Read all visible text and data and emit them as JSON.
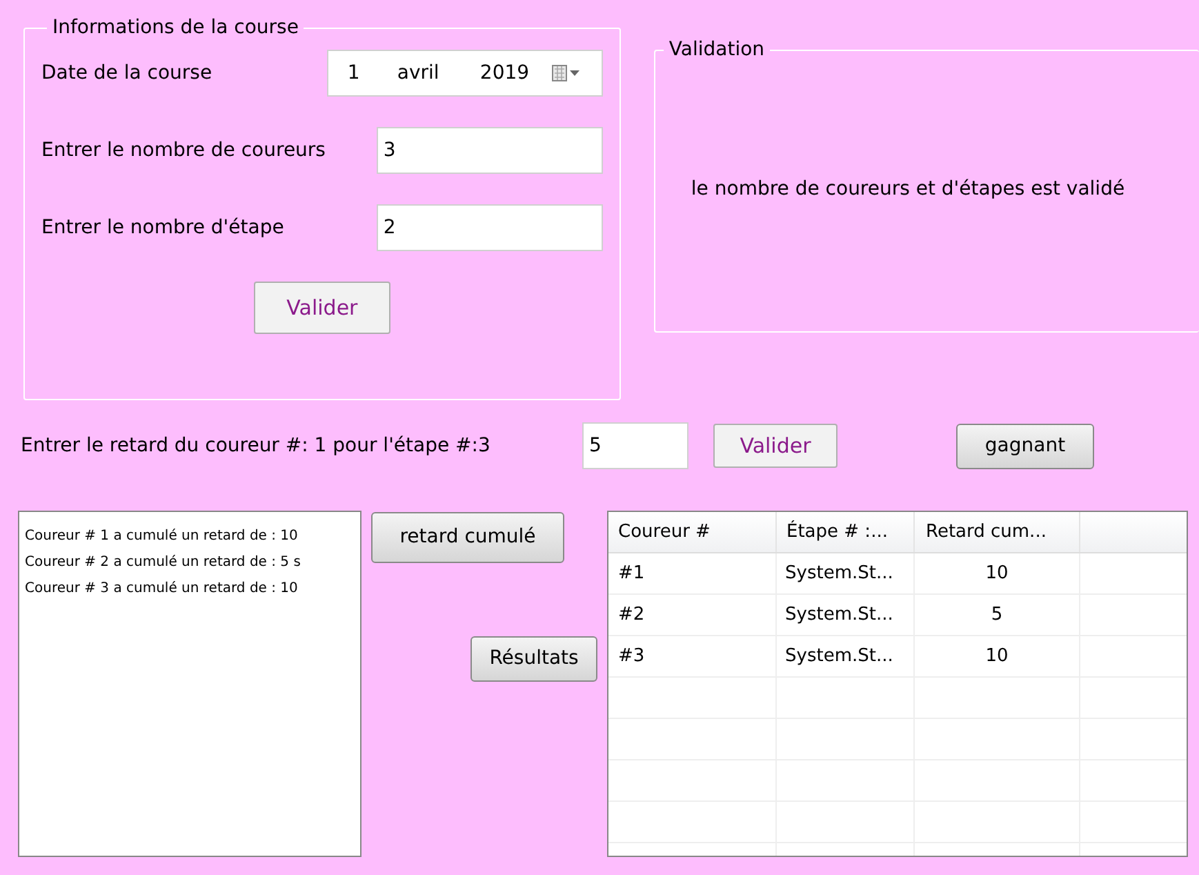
{
  "course_group": {
    "title": "Informations de la course",
    "date": {
      "label": "Date de la course",
      "day": "1",
      "month": "avril",
      "year": "2019"
    },
    "fields": [
      {
        "label": "Entrer le nombre de coureurs",
        "value": "3"
      },
      {
        "label": "Entrer le nombre d'étape",
        "value": "2"
      }
    ],
    "button": "Valider"
  },
  "validation_group": {
    "title": "Validation",
    "message": "le nombre de coureurs et d'étapes est validé"
  },
  "delay_entry": {
    "label": "Entrer le retard du coureur #: 1 pour l'étape #:3",
    "value": "5",
    "button": "Valider"
  },
  "winner_button": "gagnant",
  "cumulative_list": [
    "Coureur #  1 a cumulé un retard de :  10",
    "Coureur #  2 a cumulé un retard de :  5 s",
    "Coureur #  3 a cumulé un retard de :  10"
  ],
  "cumulative_button": "retard cumulé",
  "results_button": "Résultats",
  "table": {
    "columns": [
      "Coureur #",
      "Étape # :...",
      "Retard cum..."
    ],
    "rows": [
      [
        "#1",
        "System.St...",
        "10"
      ],
      [
        "#2",
        "System.St...",
        "5"
      ],
      [
        "#3",
        "System.St...",
        "10"
      ]
    ]
  }
}
